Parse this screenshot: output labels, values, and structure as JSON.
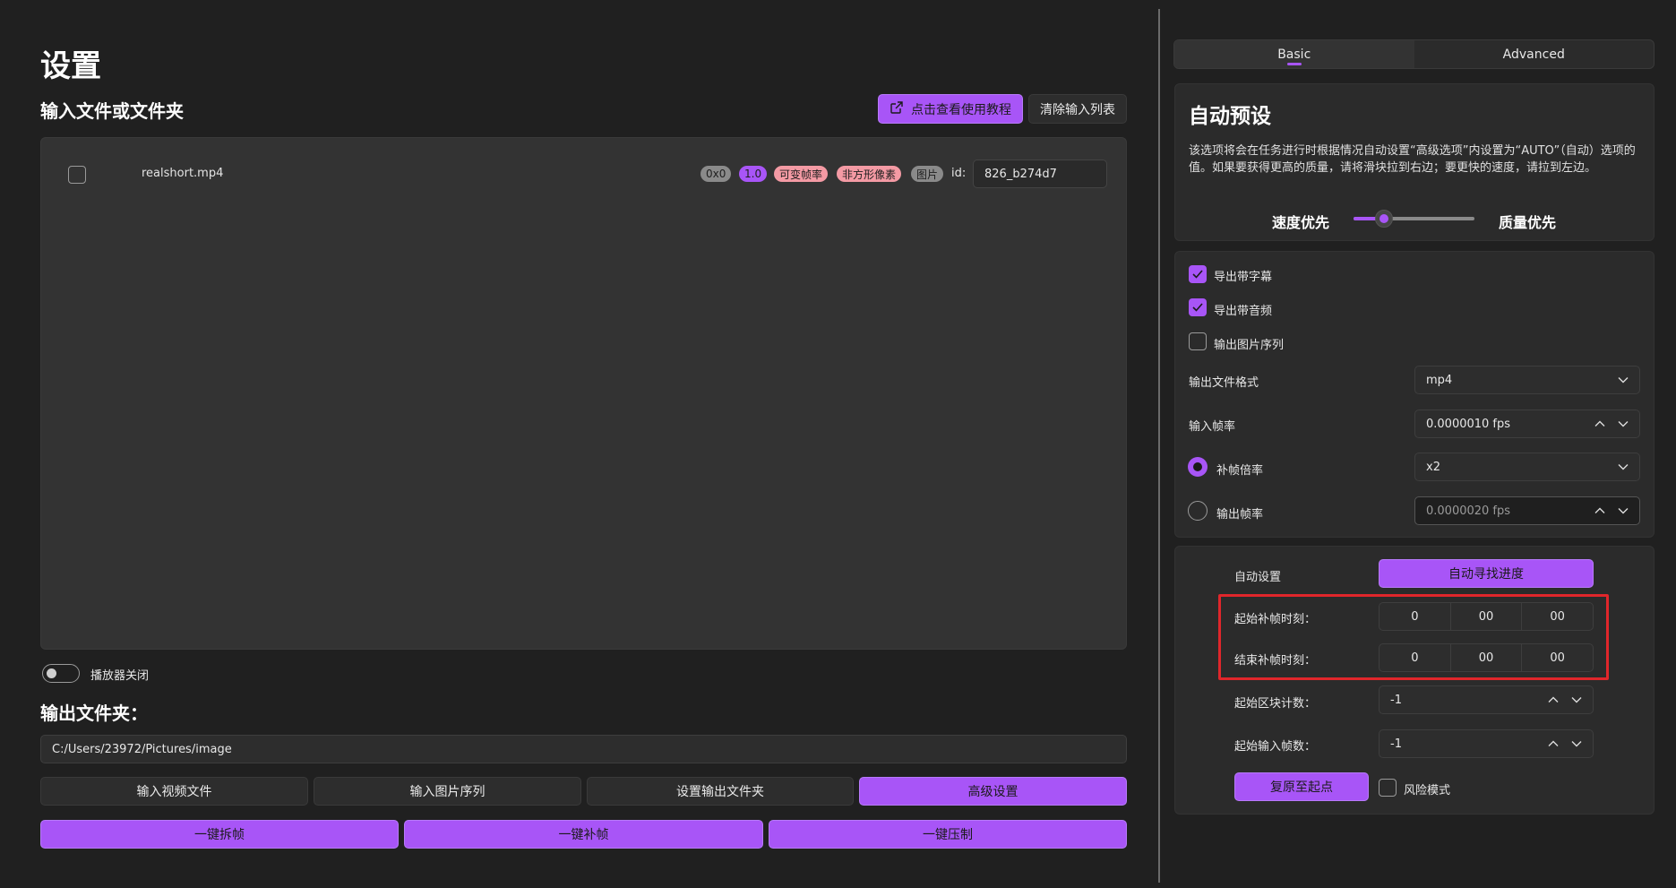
{
  "page": {
    "title": "设置",
    "input_section_title": "输入文件或文件夹",
    "tutorial_button": "点击查看使用教程",
    "clear_button": "清除输入列表"
  },
  "file_list": {
    "items": [
      {
        "name": "realshort.mp4",
        "tags": [
          "0x0",
          "1.0",
          "可变帧率",
          "非方形像素",
          "图片"
        ],
        "id_label": "id:",
        "id_value": "826_b274d7"
      }
    ]
  },
  "player": {
    "label": "播放器关闭",
    "on": false
  },
  "output": {
    "title": "输出文件夹：",
    "path": "C:/Users/23972/Pictures/image"
  },
  "actions": {
    "row1": [
      "输入视频文件",
      "输入图片序列",
      "设置输出文件夹",
      "高级设置"
    ],
    "row2": [
      "一键拆帧",
      "一键补帧",
      "一键压制"
    ]
  },
  "tabs": {
    "basic": "Basic",
    "advanced": "Advanced",
    "active": "Basic"
  },
  "preset": {
    "title": "自动预设",
    "description": "该选项将会在任务进行时根据情况自动设置“高级选项”内设置为“AUTO”（自动）选项的值。如果要获得更高的质量，请将滑块拉到右边；要更快的速度，请拉到左边。",
    "speed_label": "速度优先",
    "quality_label": "质量优先",
    "slider_level": 0.2
  },
  "export": {
    "subtitle": {
      "label": "导出带字幕",
      "checked": true
    },
    "audio": {
      "label": "导出带音频",
      "checked": true
    },
    "image_seq": {
      "label": "输出图片序列",
      "checked": false
    },
    "format_label": "输出文件格式",
    "format_value": "mp4",
    "input_fps_label": "输入帧率",
    "input_fps_value": "0.0000010 fps",
    "multiplier_label": "补帧倍率",
    "multiplier_value": "x2",
    "output_fps_label": "输出帧率",
    "output_fps_value": "0.0000020 fps"
  },
  "auto": {
    "label": "自动设置",
    "find_progress_button": "自动寻找进度",
    "start_time_label": "起始补帧时刻：",
    "start_time": [
      "0",
      "00",
      "00"
    ],
    "end_time_label": "结束补帧时刻：",
    "end_time": [
      "0",
      "00",
      "00"
    ],
    "start_chunk_label": "起始区块计数：",
    "start_chunk_value": "-1",
    "start_frame_label": "起始输入帧数：",
    "start_frame_value": "-1",
    "reset_button": "复原至起点",
    "risk_mode_label": "风险模式",
    "risk_mode_checked": false
  },
  "colors": {
    "accent": "#a855f7",
    "highlight": "#e0262b",
    "background": "#202020"
  }
}
